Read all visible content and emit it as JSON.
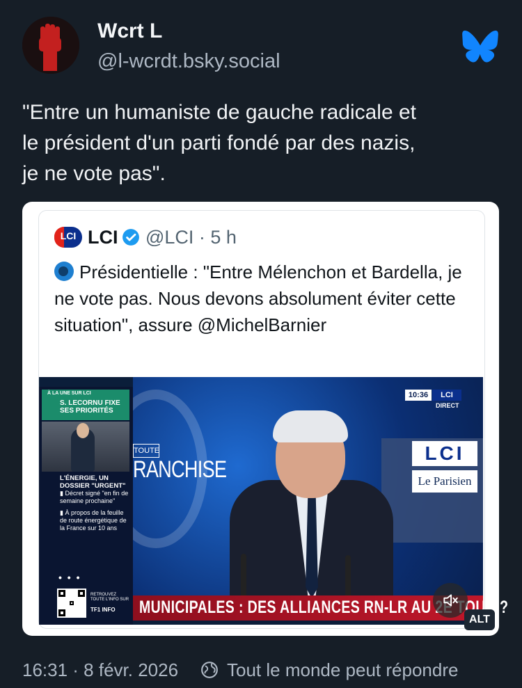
{
  "author": {
    "name": "Wcrt L",
    "handle": "@l-wcrdt.bsky.social",
    "avatar_icon": "raised-fist-icon"
  },
  "post": {
    "text": "\"Entre un humaniste de gauche radicale et\nle président d'un parti fondé par des nazis,\nje ne vote pas\"."
  },
  "quote": {
    "account_name": "LCI",
    "meta": "@LCI · 5 h",
    "text": "Présidentielle : \"Entre Mélenchon et Bardella, je ne vote pas. Nous devons absolument éviter cette situation\", assure @MichelBarnier",
    "logo_text": "LCI"
  },
  "video": {
    "sidebar_tag": "À LA UNE SUR LCI",
    "sidebar_headline": "S. LECORNU FIXE SES PRIORITÉS",
    "sidebar_section": "L'ÉNERGIE, UN DOSSIER \"URGENT\"",
    "sidebar_bullet1": "▮ Décret signé \"en fin de semaine prochaine\"",
    "sidebar_bullet2": "▮ À propos de la feuille de route énergétique de la France sur 10 ans",
    "dots": "• • •",
    "qr_note": "RETROUVEZ TOUTE L'INFO SUR",
    "tf1": "TF1 INFO",
    "toute": "TOUTE",
    "franchise": "RANCHISE",
    "clock": "10:36",
    "clock_brand": "LCI",
    "direct": "DIRECT",
    "panel_lci": "LCI",
    "panel_parisien": "Le Parisien",
    "ticker": "MUNICIPALES : DES ALLIANCES RN-LR AU 2E TOUR ?",
    "mute_icon": "mute-icon",
    "alt_label": "ALT"
  },
  "footer": {
    "timestamp": "16:31 · 8 févr. 2026",
    "reply_setting": "Tout le monde peut répondre"
  },
  "colors": {
    "background": "#161e27",
    "bluesky": "#1185fe",
    "lci_blue": "#0b2f8d",
    "ticker_red": "#c0172a"
  }
}
